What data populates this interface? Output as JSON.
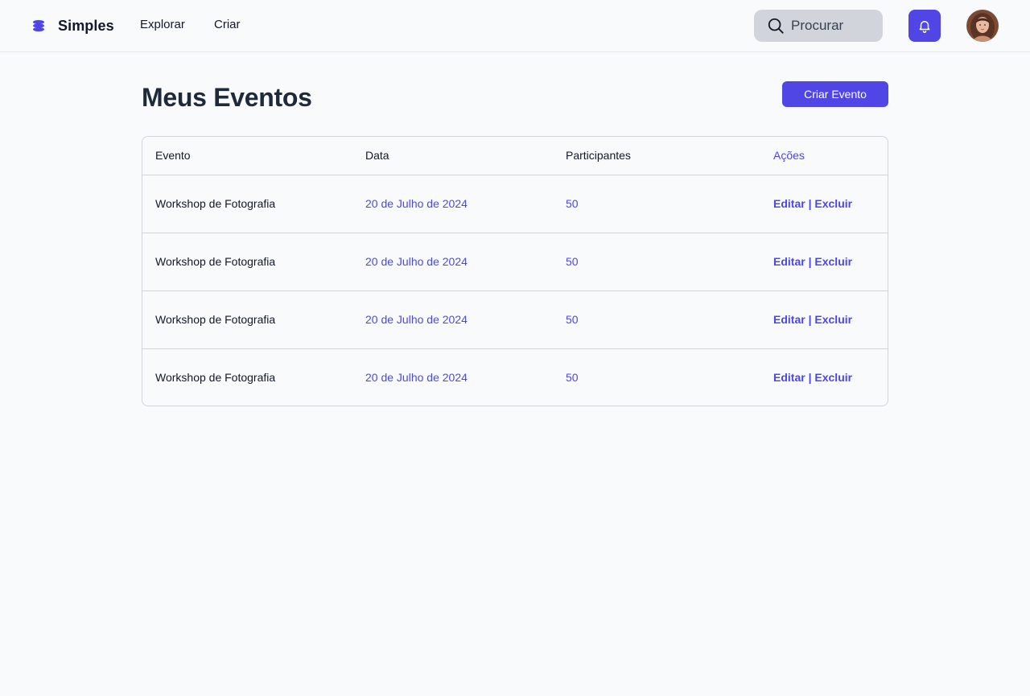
{
  "header": {
    "brand": "Simples",
    "nav": [
      {
        "label": "Explorar"
      },
      {
        "label": "Criar"
      }
    ],
    "search": {
      "placeholder": "Procurar",
      "value": ""
    },
    "accent_color": "#4f46e5"
  },
  "main": {
    "title": "Meus Eventos",
    "create_button": "Criar Evento",
    "table": {
      "columns": [
        "Evento",
        "Data",
        "Participantes",
        "Ações"
      ],
      "rows": [
        {
          "event": "Workshop de Fotografia",
          "date": "20 de Julho de 2024",
          "participants": "50",
          "edit": "Editar",
          "separator": "|",
          "delete": "Excluir"
        },
        {
          "event": "Workshop de Fotografia",
          "date": "20 de Julho de 2024",
          "participants": "50",
          "edit": "Editar",
          "separator": "|",
          "delete": "Excluir"
        },
        {
          "event": "Workshop de Fotografia",
          "date": "20 de Julho de 2024",
          "participants": "50",
          "edit": "Editar",
          "separator": "|",
          "delete": "Excluir"
        },
        {
          "event": "Workshop de Fotografia",
          "date": "20 de Julho de 2024",
          "participants": "50",
          "edit": "Editar",
          "separator": "|",
          "delete": "Excluir"
        }
      ]
    }
  }
}
